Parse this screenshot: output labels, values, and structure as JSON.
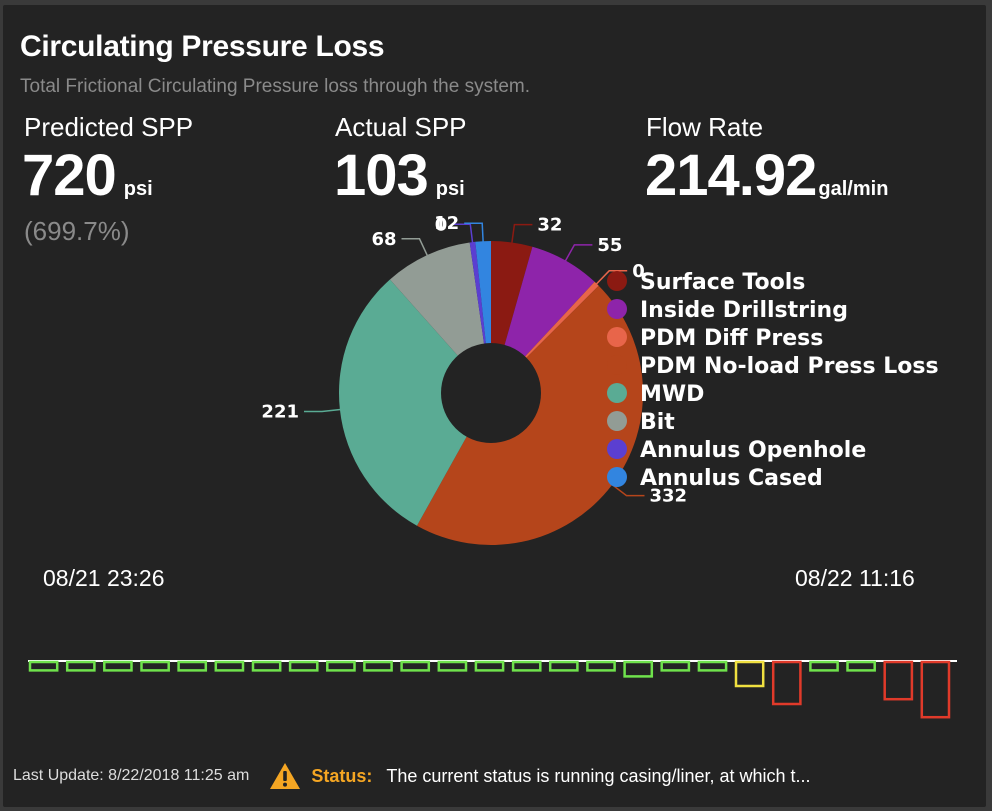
{
  "header": {
    "title": "Circulating Pressure Loss",
    "subtitle": "Total Frictional Circulating Pressure loss through the system."
  },
  "metrics": {
    "predicted": {
      "label": "Predicted SPP",
      "value": "720",
      "unit": "psi",
      "percent": "(699.7%)"
    },
    "actual": {
      "label": "Actual SPP",
      "value": "103",
      "unit": "psi"
    },
    "flow": {
      "label": "Flow Rate",
      "value": "214.92",
      "unit": "gal/min"
    }
  },
  "chart_data": {
    "type": "pie",
    "donut": true,
    "legend_position": "right",
    "slices": [
      {
        "name": "Surface Tools",
        "value": 32,
        "label": "32",
        "color": "#8b1a12"
      },
      {
        "name": "Inside Drillstring",
        "value": 55,
        "label": "55",
        "color": "#8e24aa"
      },
      {
        "name": "PDM Diff Press",
        "value": 0,
        "label": "0",
        "color": "#e8654a"
      },
      {
        "name": "PDM No-load Press Loss",
        "value": 332,
        "label": "332",
        "color": "#b5451b"
      },
      {
        "name": "MWD",
        "value": 221,
        "label": "221",
        "color": "#5aab94"
      },
      {
        "name": "Bit",
        "value": 68,
        "label": "68",
        "color": "#929c95"
      },
      {
        "name": "Annulus Openhole",
        "value": 0,
        "label": "0",
        "color": "#5b3fd1"
      },
      {
        "name": "Annulus Cased",
        "value": 12,
        "label": "12",
        "color": "#3285e0"
      }
    ]
  },
  "timeline": {
    "start": "08/21 23:26",
    "end": "08/22 11:16",
    "status_colors": {
      "ok": "#6fe24c",
      "warn": "#f0e040",
      "alert": "#e03a2a"
    },
    "bars": [
      {
        "status": "ok",
        "level": 0.14
      },
      {
        "status": "ok",
        "level": 0.14
      },
      {
        "status": "ok",
        "level": 0.14
      },
      {
        "status": "ok",
        "level": 0.14
      },
      {
        "status": "ok",
        "level": 0.14
      },
      {
        "status": "ok",
        "level": 0.14
      },
      {
        "status": "ok",
        "level": 0.14
      },
      {
        "status": "ok",
        "level": 0.14
      },
      {
        "status": "ok",
        "level": 0.14
      },
      {
        "status": "ok",
        "level": 0.14
      },
      {
        "status": "ok",
        "level": 0.14
      },
      {
        "status": "ok",
        "level": 0.14
      },
      {
        "status": "ok",
        "level": 0.14
      },
      {
        "status": "ok",
        "level": 0.14
      },
      {
        "status": "ok",
        "level": 0.14
      },
      {
        "status": "ok",
        "level": 0.14
      },
      {
        "status": "ok",
        "level": 0.24
      },
      {
        "status": "ok",
        "level": 0.14
      },
      {
        "status": "ok",
        "level": 0.14
      },
      {
        "status": "warn",
        "level": 0.4
      },
      {
        "status": "alert",
        "level": 0.7
      },
      {
        "status": "ok",
        "level": 0.14
      },
      {
        "status": "ok",
        "level": 0.14
      },
      {
        "status": "alert",
        "level": 0.62
      },
      {
        "status": "alert",
        "level": 0.92
      }
    ]
  },
  "footer": {
    "last_update": "Last Update: 8/22/2018 11:25 am",
    "status_label": "Status:",
    "status_text": "The current status is running casing/liner, at which t...",
    "warning_color": "#f5a623"
  }
}
